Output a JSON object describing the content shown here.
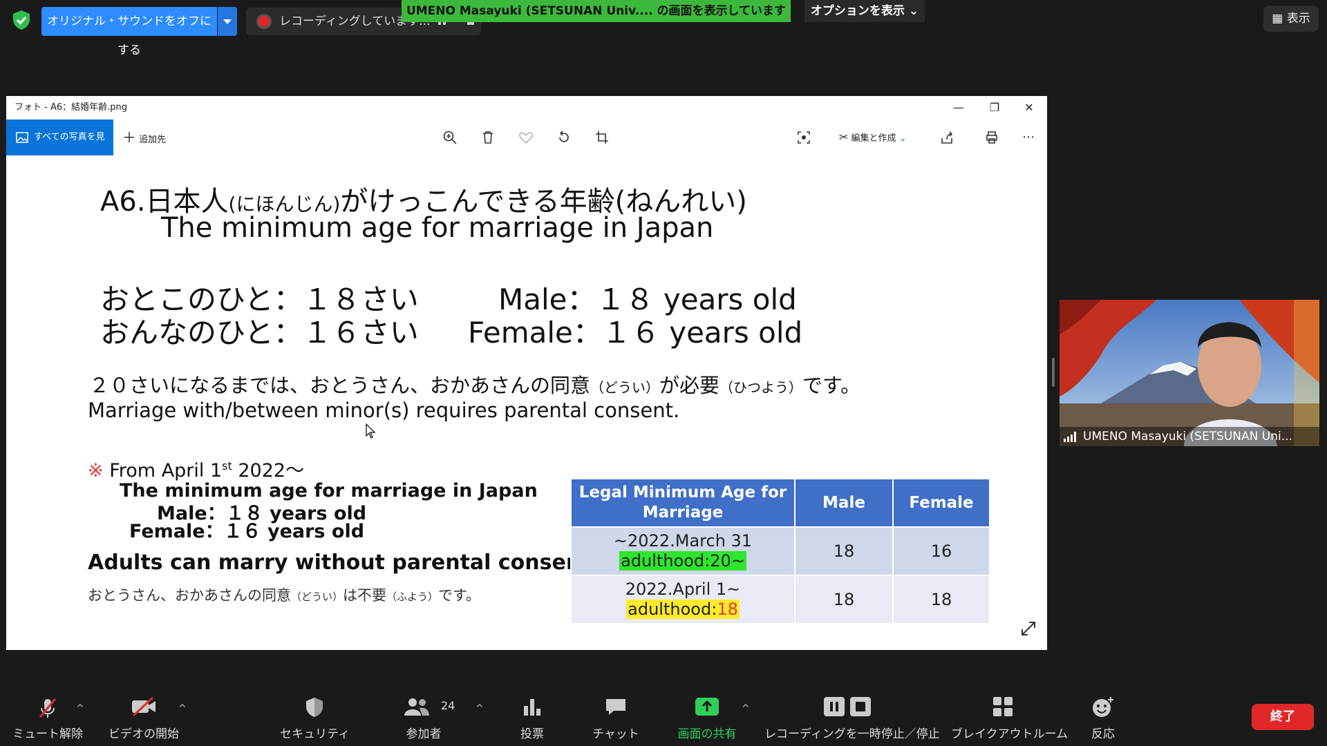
{
  "top_bar": {
    "original_sound_button": "オリジナル・サウンドをオフにする",
    "recording_label": "レコーディングしています...",
    "share_banner": "UMENO Masayuki (SETSUNAN Univ.... の画面を表示しています",
    "options_button": "オプションを表示",
    "view_button": "表示"
  },
  "photos_window": {
    "title": "フォト - A6：結婚年齢.png",
    "all_photos_button": "すべての写真を見る",
    "add_to_button": "追加先",
    "edit_create_button": "編集と作成"
  },
  "slide": {
    "title_jp": "A6.日本人",
    "title_jp_ruby": "(にほんじん)",
    "title_jp_rest": "がけっこんできる年齢",
    "title_jp_ruby2": "(ねんれい)",
    "title_en": "The minimum age for marriage in Japan",
    "male_jp": "おとこのひと：１８さい",
    "male_en": "Male：１８ years old",
    "female_jp": "おんなのひと：１６さい",
    "female_en": "Female：１６ years old",
    "consent_jp_a": "２０さいになるまでは、おとうさん、おかあさんの同意",
    "consent_jp_ruby1": "（どうい）",
    "consent_jp_b": "が必要",
    "consent_jp_ruby2": "（ひつよう）",
    "consent_jp_c": "です。",
    "consent_en": "Marriage with/between minor(s) requires parental consent.",
    "from_mark": "※",
    "from_text": "From April 1",
    "from_sup": "st",
    "from_year": "2022〜",
    "new_title": "The minimum age for marriage in Japan",
    "new_male": "Male：１８ years old",
    "new_female": "Female：１６ years old",
    "adults_line": "Adults can marry without parental consent.",
    "no_consent_jp_a": "おとうさん、おかあさんの同意",
    "no_consent_ruby1": "（どうい）",
    "no_consent_jp_b": "は不要",
    "no_consent_ruby2": "（ふよう）",
    "no_consent_jp_c": "です。",
    "table": {
      "headers": [
        "Legal Minimum Age for Marriage",
        "Male",
        "Female"
      ],
      "rows": [
        {
          "period": "~2022.March 31",
          "adulthood_label": "adulthood:",
          "adulthood_value": "20~",
          "male": "18",
          "female": "16"
        },
        {
          "period": "2022.April 1~",
          "adulthood_label": "adulthood:",
          "adulthood_value": "18",
          "male": "18",
          "female": "18"
        }
      ]
    }
  },
  "video_tile": {
    "participant_name": "UMENO Masayuki (SETSUNAN Uni..."
  },
  "bottom_bar": {
    "unmute": "ミュート解除",
    "start_video": "ビデオの開始",
    "security": "セキュリティ",
    "participants": "参加者",
    "participants_count": "24",
    "polls": "投票",
    "chat": "チャット",
    "share_screen": "画面の共有",
    "recording": "レコーディングを一時停止／停止",
    "breakout": "ブレイクアウトルーム",
    "reactions": "反応",
    "end": "終了"
  },
  "colors": {
    "zoom_blue": "#2d8cff",
    "share_green": "#3cb93c",
    "end_red": "#e02828",
    "table_header": "#3f6fc7"
  }
}
